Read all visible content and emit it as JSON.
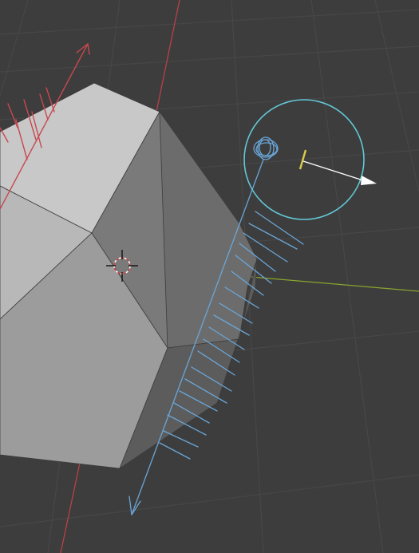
{
  "viewport": {
    "editor": "3D Viewport",
    "background_color": "#3d3d3d",
    "grid_color": "#4a4a4a",
    "x_axis_color": "#c2404a",
    "y_axis_color": "#8aa52e"
  },
  "scene": {
    "object": {
      "name": "dodecahedron-mesh",
      "face_colors": [
        "#c8c8c8",
        "#b4b4b4",
        "#787878",
        "#9a9a9a",
        "#6a6a6a",
        "#5a5a5a"
      ]
    },
    "annotations": {
      "red_stroke_color": "#c8484f",
      "blue_stroke_color": "#6aa6d8",
      "gizmo_circle_color": "#62c9d8"
    },
    "light": {
      "type": "sun",
      "color": "#d8cc4a"
    },
    "cursor_3d": {
      "icon": "3d-cursor-icon"
    }
  }
}
